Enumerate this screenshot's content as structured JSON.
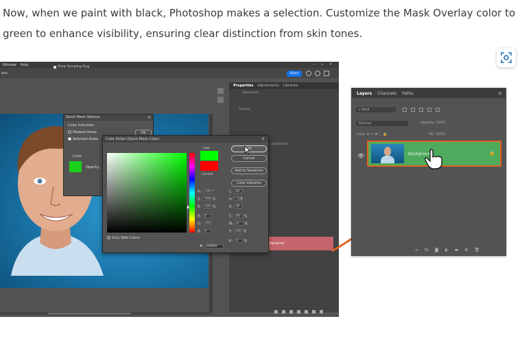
{
  "article": {
    "paragraph": "Now, when we paint with black, Photoshop makes a selection. Customize the Mask Overlay color to green to enhance visibility, ensuring clear distinction from skin tones."
  },
  "colors": {
    "overlay_green": "#00ff00",
    "current_red": "#ff0000",
    "highlight_orange": "#e0641c",
    "layer_green": "#4eaa5c",
    "share_blue": "#1473e6"
  },
  "photoshop": {
    "menu": [
      "Window",
      "Help"
    ],
    "options": {
      "field": "ons",
      "checkbox_label": "Show Sampling Ring"
    },
    "share_label": "Share",
    "properties_panel": {
      "tabs": [
        "Properties",
        "Adjustments",
        "Libraries"
      ],
      "document_label": "Document",
      "canvas_label": "Canvas",
      "pixels_label": "pixels/inch"
    },
    "background_layer_label": "Background",
    "quick_mask": {
      "title": "Quick Mask Options",
      "color_indicates": "Color Indicates:",
      "masked_areas": "Masked Areas",
      "selected_areas": "Selected Areas",
      "ok": "OK",
      "color_label": "Color",
      "opacity_label": "Opacity:"
    },
    "color_picker": {
      "title": "Color Picker (Quick Mask Color)",
      "new_label": "new",
      "current_label": "current",
      "buttons": {
        "ok": "OK",
        "cancel": "Cancel",
        "add_to_swatches": "Add to Swatches",
        "color_libraries": "Color Libraries"
      },
      "only_web_colors": "Only Web Colors",
      "values": {
        "H": "120",
        "H_unit": "°",
        "S": "100",
        "S_unit": "%",
        "B": "100",
        "B_unit": "%",
        "R": "0",
        "G": "255",
        "Bv": "0",
        "L": "83",
        "a": "-128",
        "b": "87",
        "C": "99",
        "C_unit": "%",
        "M": "0",
        "M_unit": "%",
        "Y": "100",
        "Y_unit": "%",
        "K": "0",
        "K_unit": "%"
      },
      "hex": "00ff00"
    }
  },
  "layers_panel": {
    "tabs": [
      "Layers",
      "Channels",
      "Paths"
    ],
    "kind_placeholder": "Kind",
    "blend_mode": "Normal",
    "opacity_label": "Opacity:",
    "opacity_value": "100%",
    "lock_label": "Lock:",
    "fill_label": "Fill:",
    "fill_value": "100%",
    "layer_name": "Background"
  }
}
